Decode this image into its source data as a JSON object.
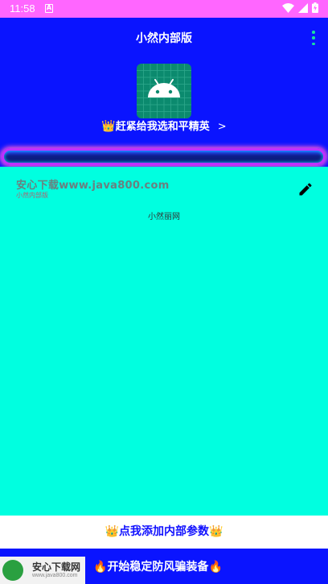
{
  "status_bar": {
    "time": "11:58",
    "notification_letter": "A",
    "icons": [
      "wifi-icon",
      "signal-icon",
      "battery-icon"
    ]
  },
  "app_bar": {
    "title": "小然内部版",
    "menu_icon": "overflow-menu-icon"
  },
  "hero": {
    "icon": "android-robot-icon",
    "promo_crown": "👑",
    "promo_text": "赶紧给我选和平精英",
    "promo_arrow": ">"
  },
  "panel": {
    "watermark_main": "安心下载www.java800.com",
    "watermark_sub": "小然内部版",
    "edit_icon": "pencil-icon",
    "caption": "小然丽网"
  },
  "add_params": {
    "crown": "👑",
    "label": "点我添加内部参数"
  },
  "bottom": {
    "badge_title": "安心下载网",
    "badge_url": "www.java800.com",
    "fire": "🔥",
    "action_label": "开始稳定防风骗装备"
  },
  "colors": {
    "primary": "#0a14ff",
    "status_bar": "#ff66ff",
    "panel": "#00ffe0",
    "crown": "#f8c000",
    "menu_dots": "#19e0a0",
    "glow": "#ff5ad9"
  }
}
